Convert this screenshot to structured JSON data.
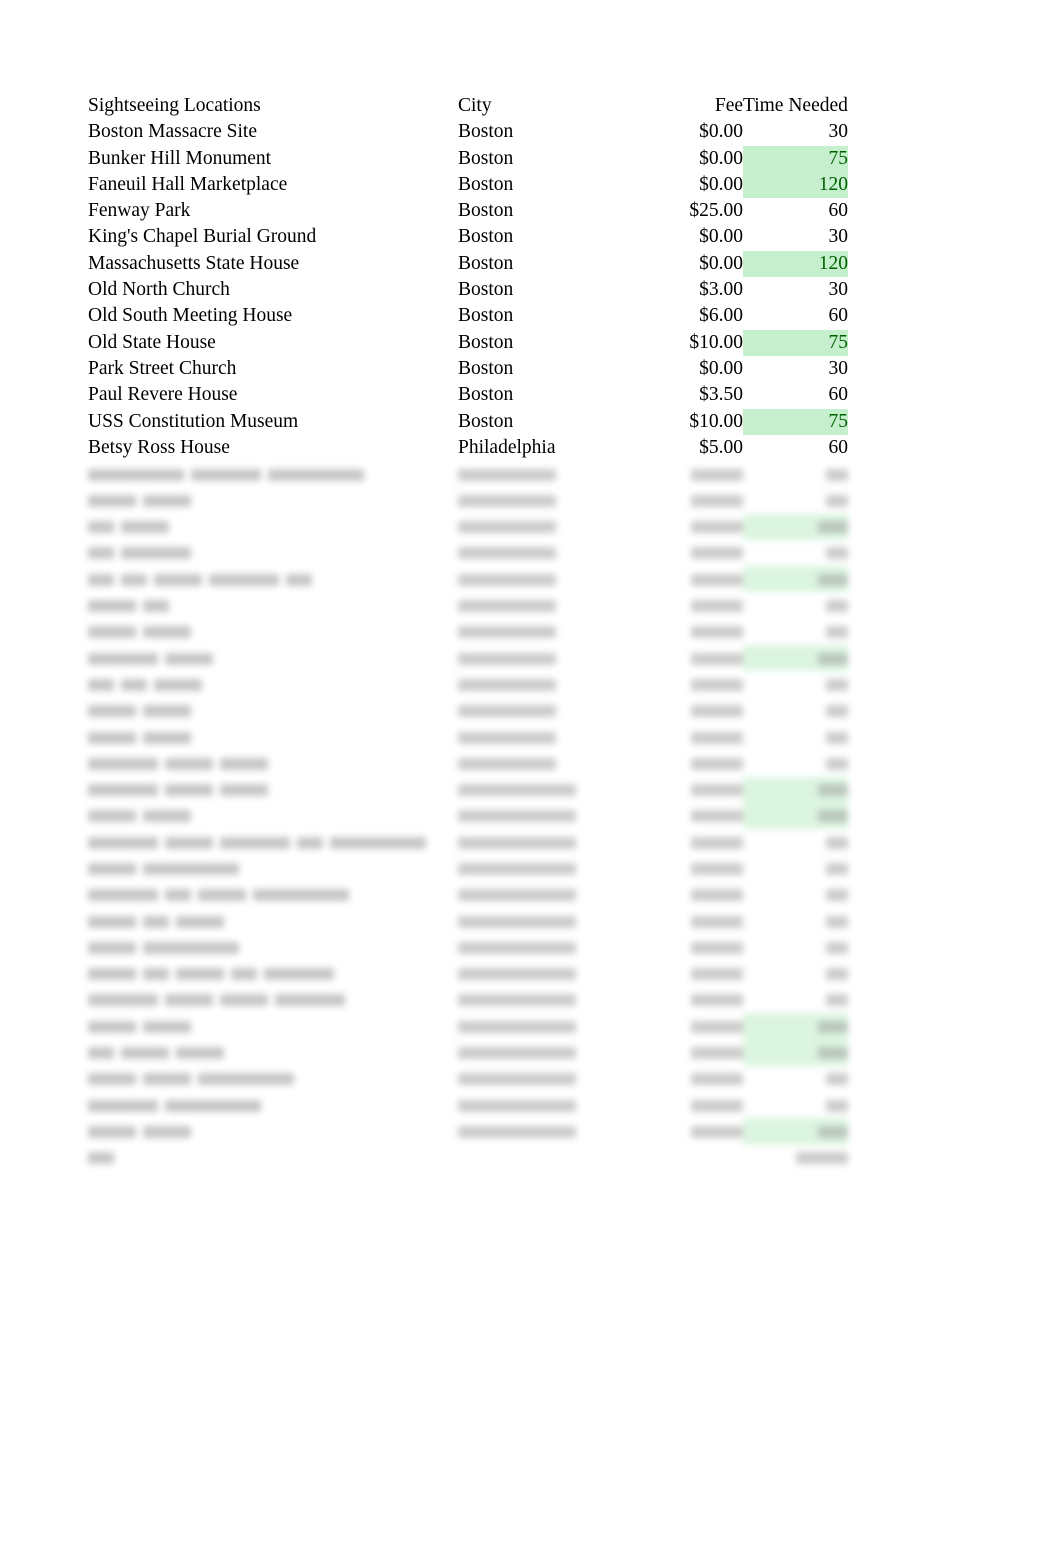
{
  "document": {
    "type": "spreadsheet-table",
    "title_visible": false
  },
  "table": {
    "columns": [
      {
        "key": "location",
        "header": "Sightseeing Locations",
        "align": "left"
      },
      {
        "key": "city",
        "header": "City",
        "align": "left"
      },
      {
        "key": "fee",
        "header": "Fee",
        "align": "right"
      },
      {
        "key": "time",
        "header": "Time Needed",
        "align": "right"
      }
    ],
    "rows": [
      {
        "location": "Boston Massacre Site",
        "city": "Boston",
        "fee": "$0.00",
        "time": "30",
        "highlight": false
      },
      {
        "location": "Bunker Hill Monument",
        "city": "Boston",
        "fee": "$0.00",
        "time": "75",
        "highlight": true
      },
      {
        "location": "Faneuil Hall Marketplace",
        "city": "Boston",
        "fee": "$0.00",
        "time": "120",
        "highlight": true
      },
      {
        "location": "Fenway Park",
        "city": "Boston",
        "fee": "$25.00",
        "time": "60",
        "highlight": false
      },
      {
        "location": "King's Chapel Burial Ground",
        "city": "Boston",
        "fee": "$0.00",
        "time": "30",
        "highlight": false
      },
      {
        "location": "Massachusetts State House",
        "city": "Boston",
        "fee": "$0.00",
        "time": "120",
        "highlight": true
      },
      {
        "location": "Old North Church",
        "city": "Boston",
        "fee": "$3.00",
        "time": "30",
        "highlight": false
      },
      {
        "location": "Old South Meeting House",
        "city": "Boston",
        "fee": "$6.00",
        "time": "60",
        "highlight": false
      },
      {
        "location": "Old State House",
        "city": "Boston",
        "fee": "$10.00",
        "time": "75",
        "highlight": true
      },
      {
        "location": "Park Street Church",
        "city": "Boston",
        "fee": "$0.00",
        "time": "30",
        "highlight": false
      },
      {
        "location": "Paul Revere House",
        "city": "Boston",
        "fee": "$3.50",
        "time": "60",
        "highlight": false
      },
      {
        "location": "USS Constitution Museum",
        "city": "Boston",
        "fee": "$10.00",
        "time": "75",
        "highlight": true
      },
      {
        "location": "Betsy Ross House",
        "city": "Philadelphia",
        "fee": "$5.00",
        "time": "60",
        "highlight": false
      }
    ]
  },
  "obscured_region": {
    "note": "Lower portion of the table is visually blurred in the source screenshot; individual text is not legible.",
    "approx_row_count": 28,
    "rows": [
      {
        "name_widths": [
          "xl",
          "l",
          "xl"
        ],
        "city": "philadelphia",
        "highlight": false
      },
      {
        "name_widths": [
          "m",
          "m"
        ],
        "city": "philadelphia",
        "highlight": false
      },
      {
        "name_widths": [
          "s",
          "m"
        ],
        "city": "philadelphia",
        "highlight": true
      },
      {
        "name_widths": [
          "s",
          "l"
        ],
        "city": "philadelphia",
        "highlight": false
      },
      {
        "name_widths": [
          "s",
          "s",
          "m",
          "l",
          "s"
        ],
        "city": "philadelphia",
        "highlight": true
      },
      {
        "name_widths": [
          "m",
          "s"
        ],
        "city": "philadelphia",
        "highlight": false
      },
      {
        "name_widths": [
          "m",
          "m"
        ],
        "city": "philadelphia",
        "highlight": false
      },
      {
        "name_widths": [
          "l",
          "m"
        ],
        "city": "philadelphia",
        "highlight": true
      },
      {
        "name_widths": [
          "s",
          "s",
          "m"
        ],
        "city": "philadelphia",
        "highlight": false
      },
      {
        "name_widths": [
          "m",
          "m"
        ],
        "city": "philadelphia",
        "highlight": false
      },
      {
        "name_widths": [
          "m",
          "m"
        ],
        "city": "philadelphia",
        "highlight": false
      },
      {
        "name_widths": [
          "l",
          "m",
          "m"
        ],
        "city": "philadelphia",
        "highlight": false
      },
      {
        "name_widths": [
          "l",
          "m",
          "m"
        ],
        "city": "washington",
        "highlight": true
      },
      {
        "name_widths": [
          "m",
          "m"
        ],
        "city": "washington",
        "highlight": true
      },
      {
        "name_widths": [
          "l",
          "m",
          "l",
          "s",
          "xl"
        ],
        "city": "washington",
        "highlight": false
      },
      {
        "name_widths": [
          "m",
          "xl"
        ],
        "city": "washington",
        "highlight": false
      },
      {
        "name_widths": [
          "l",
          "s",
          "m",
          "xl"
        ],
        "city": "washington",
        "highlight": false
      },
      {
        "name_widths": [
          "m",
          "s",
          "m"
        ],
        "city": "washington",
        "highlight": false
      },
      {
        "name_widths": [
          "m",
          "xl"
        ],
        "city": "washington",
        "highlight": false
      },
      {
        "name_widths": [
          "m",
          "s",
          "m",
          "s",
          "l"
        ],
        "city": "washington",
        "highlight": false
      },
      {
        "name_widths": [
          "l",
          "m",
          "m",
          "l"
        ],
        "city": "washington",
        "highlight": false
      },
      {
        "name_widths": [
          "m",
          "m"
        ],
        "city": "washington",
        "highlight": true
      },
      {
        "name_widths": [
          "s",
          "m",
          "m"
        ],
        "city": "washington",
        "highlight": true
      },
      {
        "name_widths": [
          "m",
          "m",
          "xl"
        ],
        "city": "washington",
        "highlight": false
      },
      {
        "name_widths": [
          "l",
          "xl"
        ],
        "city": "washington",
        "highlight": false
      },
      {
        "name_widths": [
          "m",
          "m"
        ],
        "city": "washington",
        "highlight": true
      }
    ],
    "total_row": {
      "label_width": "s",
      "value_width": "m"
    }
  },
  "colors": {
    "highlight_background": "#c6efce",
    "highlight_text": "#006100",
    "text": "#000000",
    "page_background": "#ffffff"
  }
}
